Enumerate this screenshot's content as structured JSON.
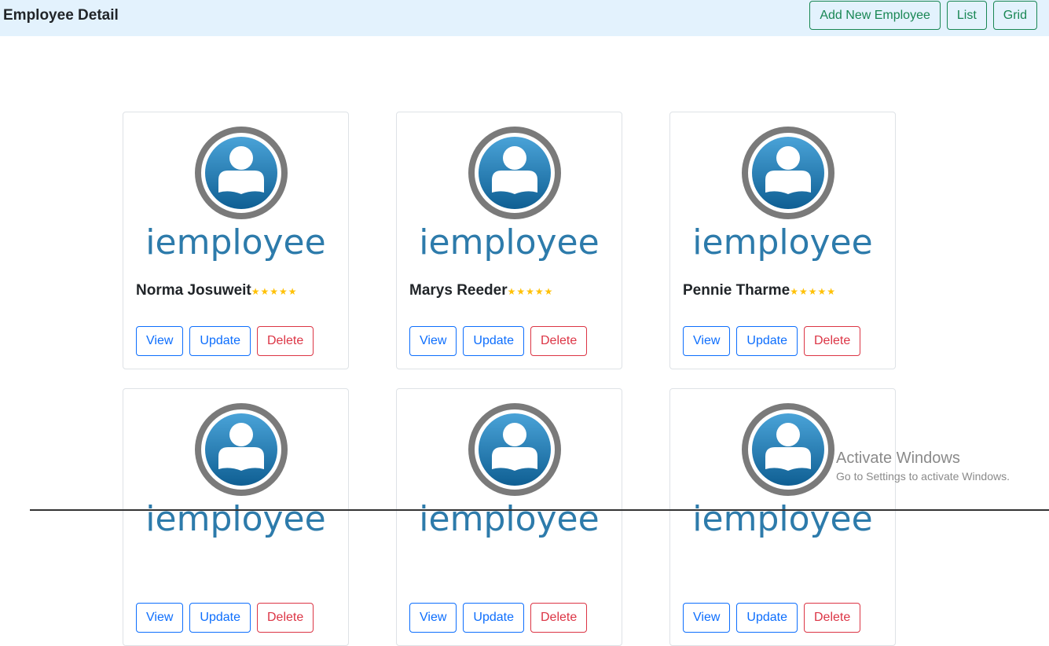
{
  "navbar": {
    "title": "Employee Detail",
    "buttons": [
      {
        "label": "Add New Employee"
      },
      {
        "label": "List"
      },
      {
        "label": "Grid"
      }
    ]
  },
  "logo_text": "iemployee",
  "colors": {
    "navbar_bg": "#e3f2fd",
    "success": "#198754",
    "primary": "#0d6efd",
    "danger": "#dc3545",
    "star": "#ffc107"
  },
  "card_actions": {
    "view": "View",
    "update": "Update",
    "delete": "Delete"
  },
  "employees": [
    {
      "name": "Norma Josuweit",
      "rating": 5
    },
    {
      "name": "Marys Reeder",
      "rating": 5
    },
    {
      "name": "Pennie Tharme",
      "rating": 5
    },
    {
      "name": "",
      "rating": null
    },
    {
      "name": "",
      "rating": null
    },
    {
      "name": "",
      "rating": null
    }
  ],
  "watermark": {
    "title": "Activate Windows",
    "subtitle": "Go to Settings to activate Windows."
  }
}
